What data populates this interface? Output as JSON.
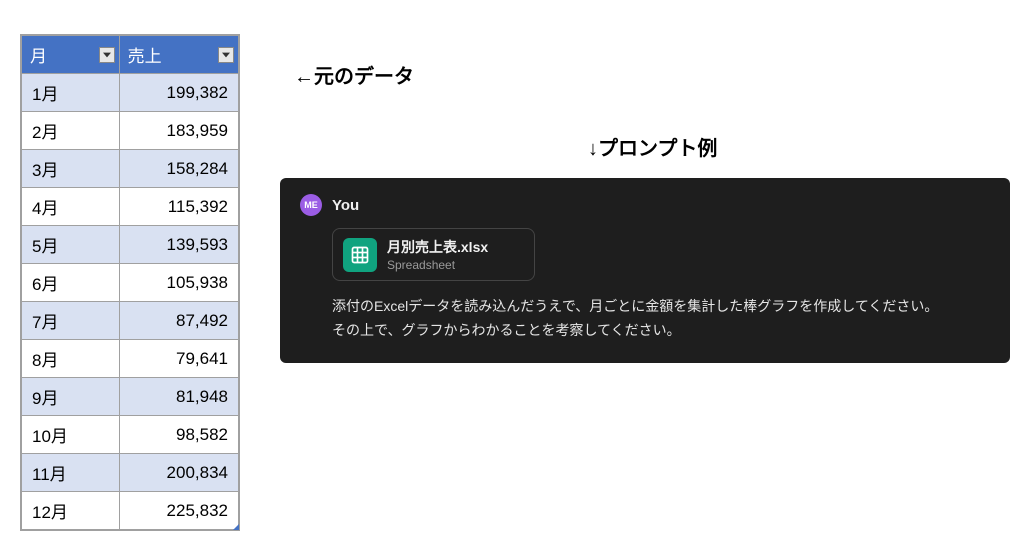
{
  "table": {
    "headers": {
      "month": "月",
      "sales": "売上"
    },
    "rows": [
      {
        "month": "1月",
        "sales": "199,382"
      },
      {
        "month": "2月",
        "sales": "183,959"
      },
      {
        "month": "3月",
        "sales": "158,284"
      },
      {
        "month": "4月",
        "sales": "115,392"
      },
      {
        "month": "5月",
        "sales": "139,593"
      },
      {
        "month": "6月",
        "sales": "105,938"
      },
      {
        "month": "7月",
        "sales": "87,492"
      },
      {
        "month": "8月",
        "sales": "79,641"
      },
      {
        "month": "9月",
        "sales": "81,948"
      },
      {
        "month": "10月",
        "sales": "98,582"
      },
      {
        "month": "11月",
        "sales": "200,834"
      },
      {
        "month": "12月",
        "sales": "225,832"
      }
    ]
  },
  "labels": {
    "source_data": "←元のデータ",
    "prompt_example": "↓プロンプト例"
  },
  "prompt": {
    "user_avatar_initials": "ME",
    "user_name": "You",
    "file": {
      "name": "月別売上表.xlsx",
      "type": "Spreadsheet"
    },
    "text_line1": "添付のExcelデータを読み込んだうえで、月ごとに金額を集計した棒グラフを作成してください。",
    "text_line2": "その上で、グラフからわかることを考察してください。"
  }
}
